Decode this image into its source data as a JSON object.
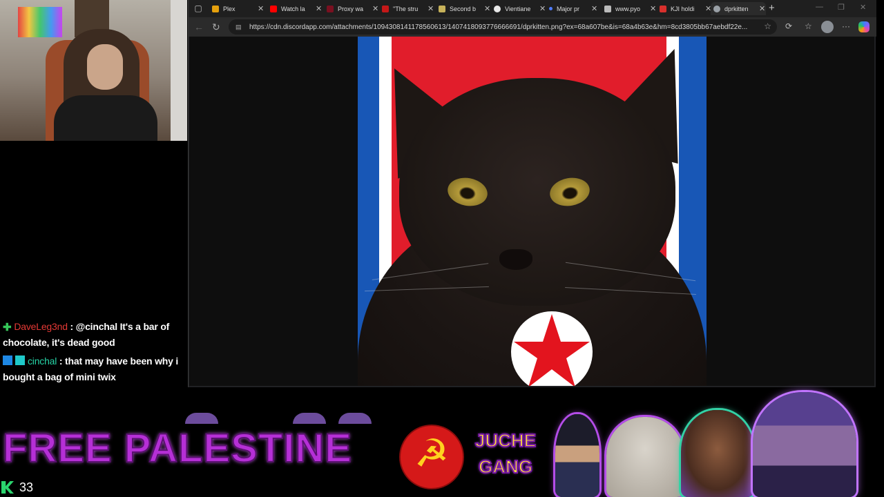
{
  "browser": {
    "tabs": [
      {
        "label": "Plex",
        "favicon_color": "#e5a00d",
        "active": false
      },
      {
        "label": "Watch la",
        "favicon_color": "#ff0000",
        "active": false
      },
      {
        "label": "Proxy wa",
        "favicon_color": "#7a1020",
        "active": false
      },
      {
        "label": "\"The stru",
        "favicon_color": "#c41818",
        "active": false
      },
      {
        "label": "Second b",
        "favicon_color": "#c7b25a",
        "active": false
      },
      {
        "label": "Vientiane",
        "favicon_color": "#e8e8e8",
        "active": false
      },
      {
        "label": "Major pr",
        "favicon_color": "#4f7cff",
        "active": false
      },
      {
        "label": "www.pyo",
        "favicon_color": "#bbbbbb",
        "active": false
      },
      {
        "label": "KJI holdi",
        "favicon_color": "#d9302c",
        "active": false
      },
      {
        "label": "dprkitten",
        "favicon_color": "#9aa0a6",
        "active": true
      }
    ],
    "url": "https://cdn.discordapp.com/attachments/1094308141178560613/1407418093776666691/dprkitten.png?ex=68a607be&is=68a4b63e&hm=8cd3805bb67aebdf22e..."
  },
  "chat": {
    "messages": [
      {
        "user": "DaveLeg3nd",
        "text": ": @cinchal It's a bar of chocolate, it's dead good"
      },
      {
        "user": "cinchal",
        "text": ": that may have been why i bought a bag of mini twix"
      }
    ]
  },
  "banner": {
    "text": "FREE PALESTINE",
    "juche_line1": "JUCHE",
    "juche_line2": "GANG"
  },
  "viewer_count": "33"
}
